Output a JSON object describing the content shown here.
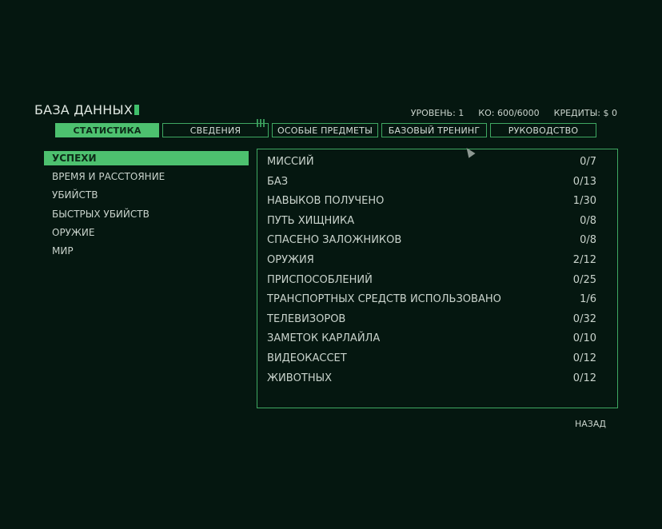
{
  "header": {
    "title": "БАЗА ДАННЫХ",
    "level": "УРОВЕНЬ: 1",
    "ko": "КО: 600/6000",
    "credits": "КРЕДИТЫ: $ 0"
  },
  "tabs": [
    {
      "label": "СТАТИСТИКА",
      "active": true
    },
    {
      "label": "СВЕДЕНИЯ"
    },
    {
      "label": "ОСОБЫЕ ПРЕДМЕТЫ"
    },
    {
      "label": "БАЗОВЫЙ ТРЕНИНГ"
    },
    {
      "label": "РУКОВОДСТВО"
    }
  ],
  "sidebar": {
    "items": [
      {
        "label": "УСПЕХИ",
        "active": true
      },
      {
        "label": "ВРЕМЯ И РАССТОЯНИЕ"
      },
      {
        "label": "УБИЙСТВ"
      },
      {
        "label": "БЫСТРЫХ УБИЙСТВ"
      },
      {
        "label": "ОРУЖИЕ"
      },
      {
        "label": "МИР"
      }
    ]
  },
  "stats": {
    "rows": [
      {
        "label": "МИССИЙ",
        "value": "0/7"
      },
      {
        "label": "БАЗ",
        "value": "0/13"
      },
      {
        "label": "НАВЫКОВ ПОЛУЧЕНО",
        "value": "1/30"
      },
      {
        "label": "ПУТЬ ХИЩНИКА",
        "value": "0/8"
      },
      {
        "label": "СПАСЕНО ЗАЛОЖНИКОВ",
        "value": "0/8"
      },
      {
        "label": "ОРУЖИЯ",
        "value": "2/12"
      },
      {
        "label": "ПРИСПОСОБЛЕНИЙ",
        "value": "0/25"
      },
      {
        "label": "ТРАНСПОРТНЫХ СРЕДСТВ ИСПОЛЬЗОВАНО",
        "value": "1/6"
      },
      {
        "label": "ТЕЛЕВИЗОРОВ",
        "value": "0/32"
      },
      {
        "label": "ЗАМЕТОК КАРЛАЙЛА",
        "value": "0/10"
      },
      {
        "label": "ВИДЕОКАССЕТ",
        "value": "0/12"
      },
      {
        "label": "ЖИВОТНЫХ",
        "value": "0/12"
      }
    ]
  },
  "footer": {
    "back_label": "НАЗАД"
  },
  "colors": {
    "background": "#051710",
    "accent": "#4dc16f",
    "border": "#3fa862",
    "text": "#c9d3cc"
  }
}
